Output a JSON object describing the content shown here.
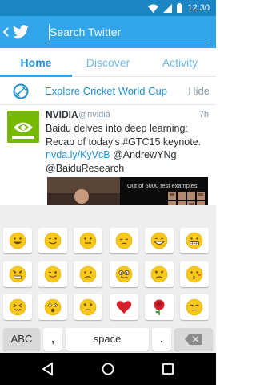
{
  "status_bar": {
    "time": "12:30"
  },
  "app_bar": {
    "search_placeholder": "Search Twitter"
  },
  "tabs": [
    {
      "label": "Home"
    },
    {
      "label": "Discover"
    },
    {
      "label": "Activity"
    }
  ],
  "explore": {
    "text": "Explore Cricket World Cup",
    "hide_label": "Hide"
  },
  "tweet": {
    "name": "NVIDIA",
    "handle": "@nvidia",
    "time": "7h",
    "text_main": "Baidu delves into deep learning: Recap of today's #GTC15 keynote. ",
    "link": "nvda.ly/KyVcB",
    "text_mentions": " @AndrewYNg @BaiduResearch",
    "media_caption": "Out of 6000 test examples"
  },
  "keyboard": {
    "emoji_rows": [
      [
        "grinning-face",
        "winking-face",
        "neutral-face",
        "pensive-face",
        "big-smile-face",
        "grimacing-face"
      ],
      [
        "angry-face",
        "winking-tongue-face",
        "sad-face",
        "nerd-glasses-face",
        "frowning-face",
        "kiss-face"
      ],
      [
        "confounded-face",
        "astonished-face",
        "worried-face",
        "red-heart",
        "red-rose",
        "unamused-face"
      ]
    ],
    "abc_label": "ABC",
    "comma_label": ",",
    "space_label": "space",
    "period_label": "."
  },
  "colors": {
    "twitter_blue": "#32a4ea",
    "status_blue": "#1b86c4",
    "link_blue": "#1f91d8",
    "nvidia_green": "#76b900"
  }
}
